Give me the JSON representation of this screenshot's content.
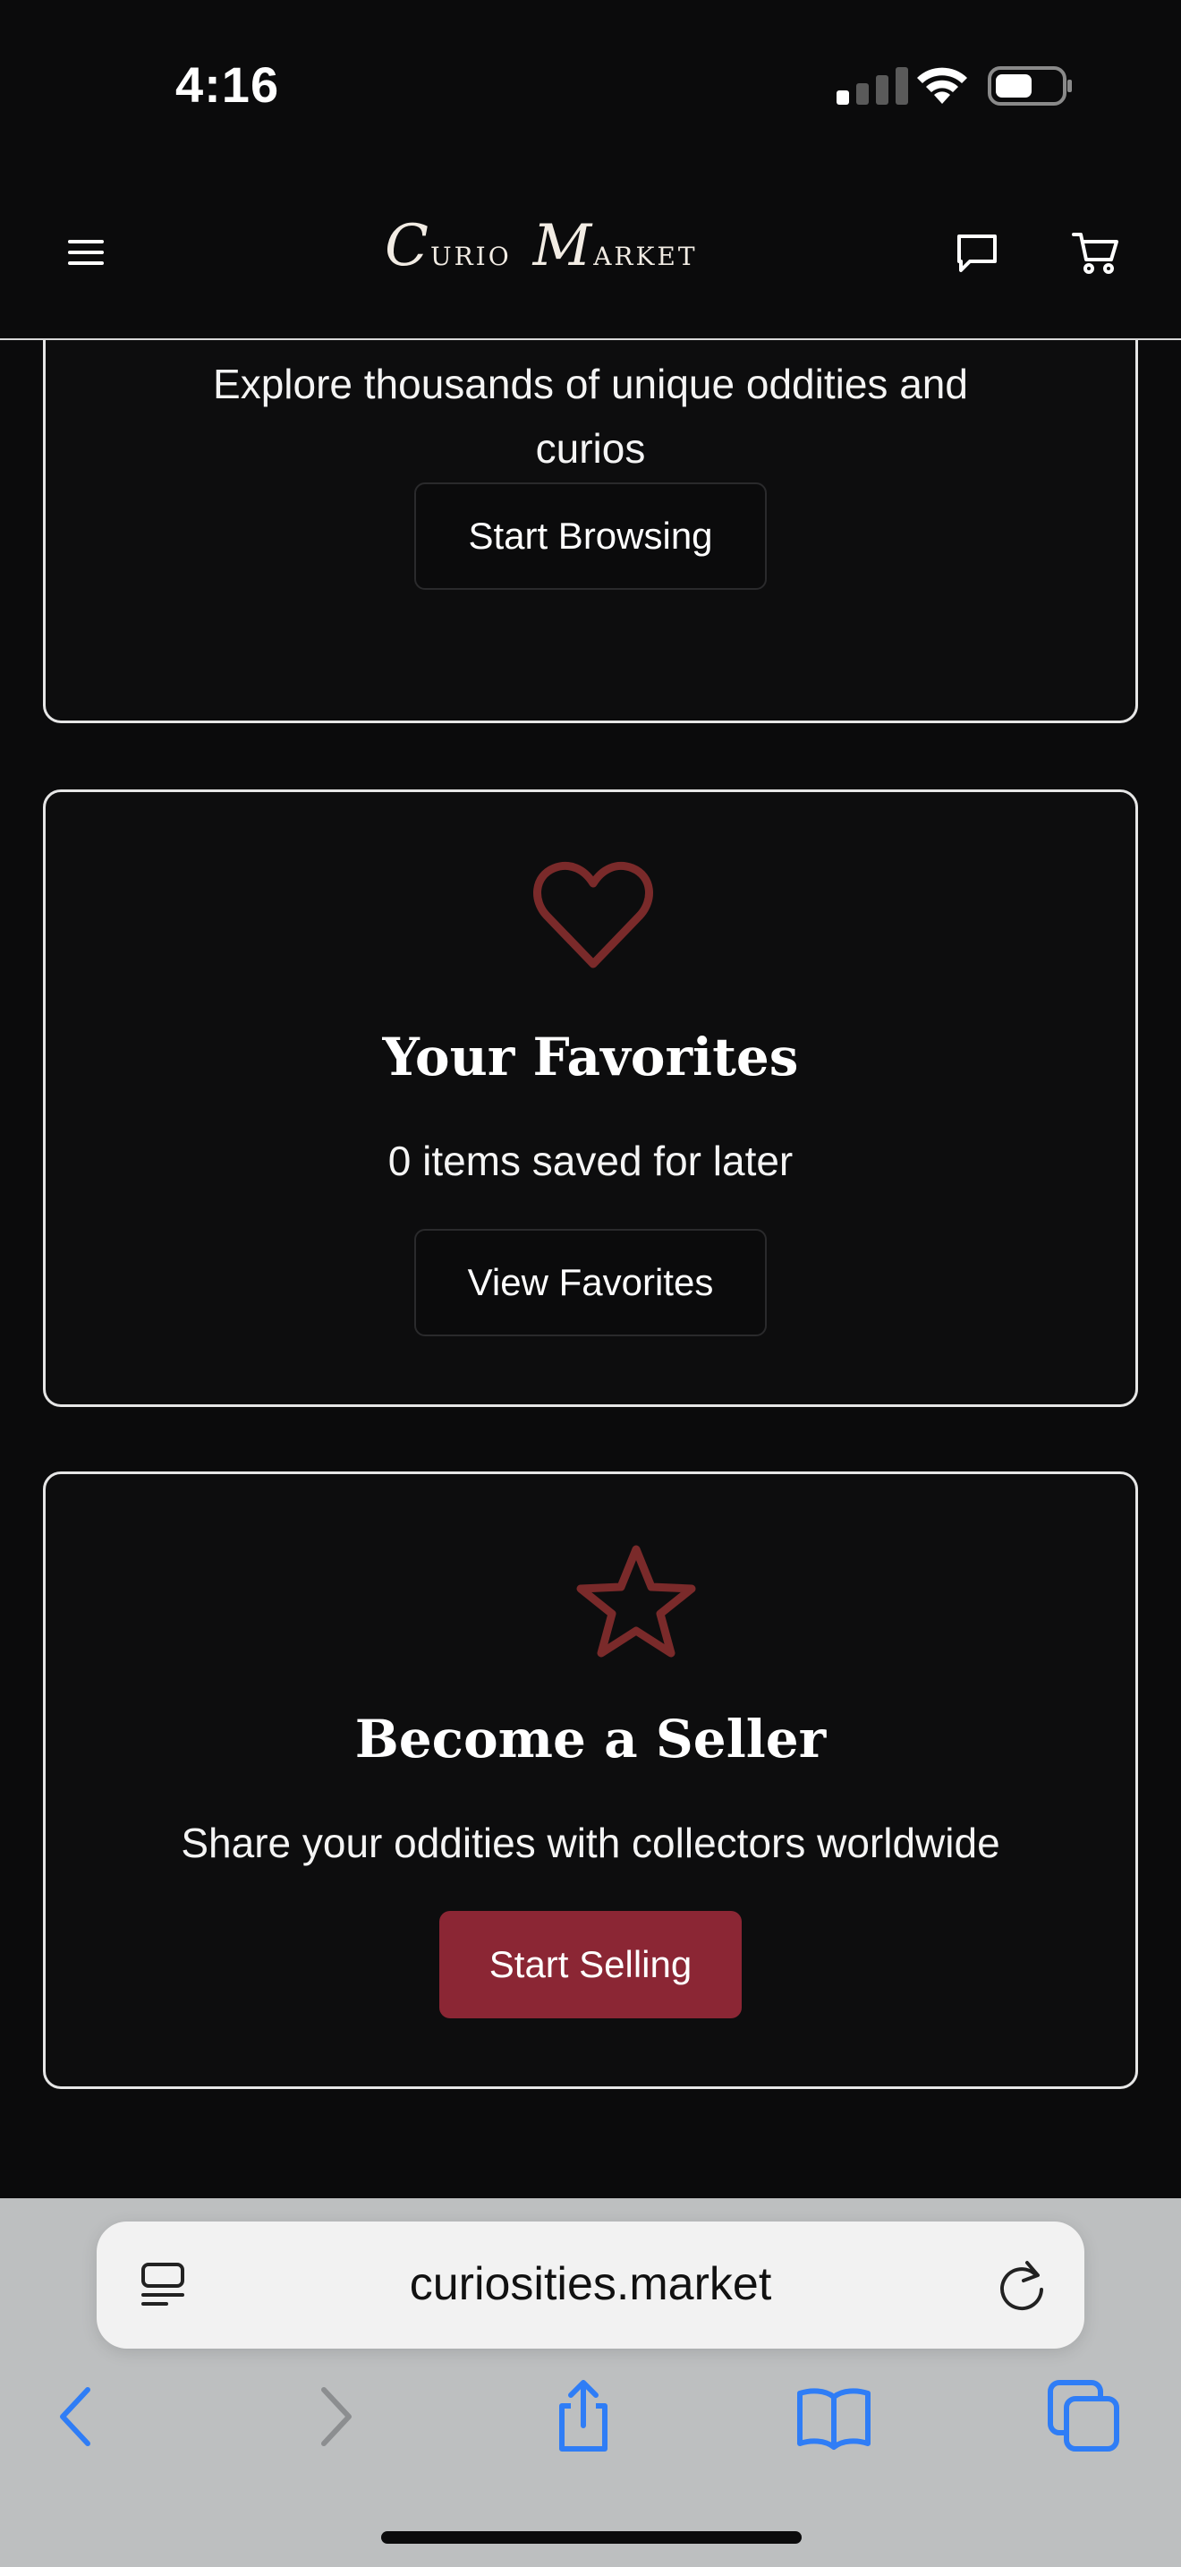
{
  "status_bar": {
    "time": "4:16"
  },
  "header": {
    "logo": {
      "word1_cap": "C",
      "word1_rest": "urio",
      "word2_cap": "M",
      "word2_rest": "arket"
    },
    "icons": [
      "menu-icon",
      "chat-icon",
      "cart-icon"
    ]
  },
  "cards": {
    "browse": {
      "title_fragment": "",
      "description": "Explore thousands of unique oddities and curios",
      "button": "Start Browsing"
    },
    "favorites": {
      "icon": "heart-icon",
      "title": "Your Favorites",
      "description": "0 items saved for later",
      "button": "View Favorites"
    },
    "seller": {
      "icon": "star-icon",
      "title": "Become a Seller",
      "description": "Share your oddities with collectors worldwide",
      "button": "Start Selling"
    }
  },
  "browser": {
    "url": "curiosities.market",
    "icons": [
      "reader-icon",
      "reload-icon",
      "back-icon",
      "forward-icon",
      "share-icon",
      "bookmarks-icon",
      "tabs-icon"
    ]
  },
  "colors": {
    "background": "#0b0b0c",
    "accent": "#8b2634",
    "icon_accent": "#7a2a2a",
    "safari_blue": "#2f7df6"
  }
}
